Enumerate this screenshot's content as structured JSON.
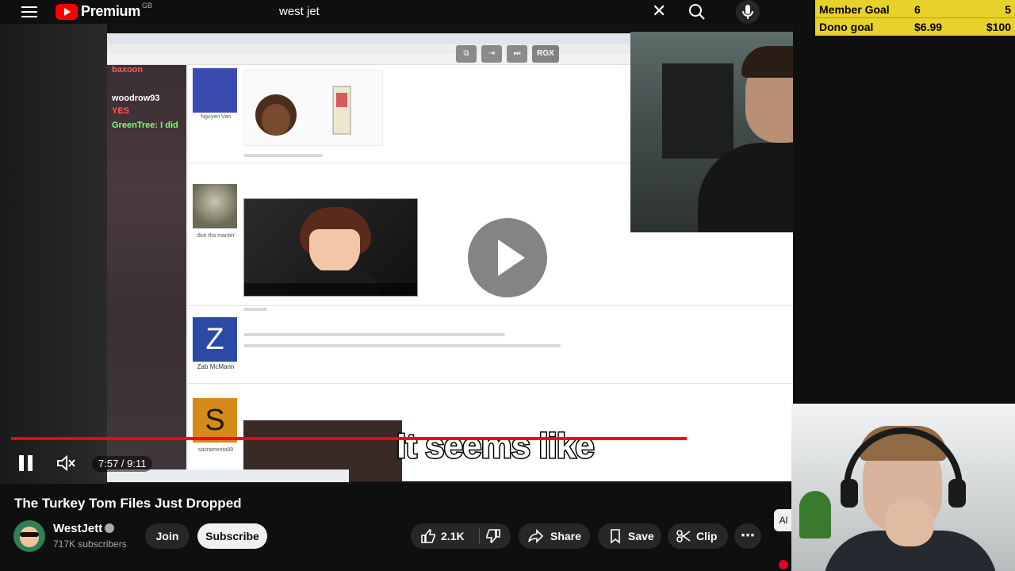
{
  "header": {
    "logo_text": "Premium",
    "logo_region": "GB",
    "search_query": "west jet"
  },
  "goals": {
    "member": {
      "label": "Member Goal",
      "current": "6",
      "target": "5"
    },
    "dono": {
      "label": "Dono goal",
      "current": "$6.99",
      "target": "$100"
    }
  },
  "video": {
    "caption": "It seems like",
    "time": "7:57 / 9:11",
    "progress": 0.866,
    "mini_controls": {
      "rgx": "RGX"
    },
    "chat": [
      {
        "user": "baxoon",
        "text": "",
        "color": "#ff4d4d"
      },
      {
        "user": "woodrow93",
        "text": "",
        "color": "#ffffff"
      },
      {
        "user": "",
        "text": "YES",
        "color": "#ff4d4d"
      },
      {
        "user": "GreenTree",
        "text": "I did",
        "color": "#7dff7d"
      }
    ],
    "forum_users": {
      "user1": "Nguyen Van",
      "user2": "dick tha manter",
      "user3": "Zab McMann",
      "user4": "sacramento89"
    },
    "avatar_letters": {
      "z": "Z",
      "s": "S"
    }
  },
  "meta": {
    "title": "The Turkey Tom Files Just Dropped",
    "channel_name": "WestJett",
    "subscribers": "717K subscribers",
    "join_label": "Join",
    "subscribe_label": "Subscribe",
    "like_count": "2.1K",
    "share_label": "Share",
    "save_label": "Save",
    "clip_label": "Clip",
    "side_chip": "Al"
  },
  "colors": {
    "accent": "#ff0000",
    "goal_bg": "#e6d22a"
  }
}
